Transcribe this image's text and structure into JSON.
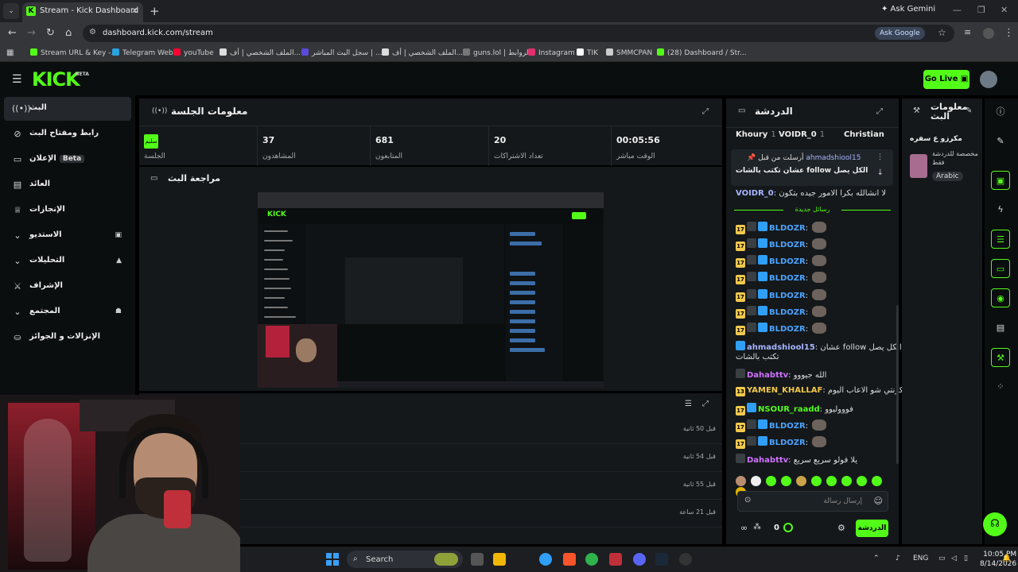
{
  "browser": {
    "tab_title": "Stream - Kick Dashboard",
    "tab_favicon": "K",
    "new_tab": "+",
    "ask_gemini": "✦ Ask Gemini",
    "url": "dashboard.kick.com/stream",
    "ask_google": "Ask Google",
    "bookmarks": [
      {
        "label": "Stream URL & Key -...",
        "color": "#53fc18"
      },
      {
        "label": "Telegram Web",
        "color": "#2aa3e0"
      },
      {
        "label": "youTube",
        "color": "#ff0033"
      },
      {
        "label": "الملف الشخصي | أف...",
        "color": "#dddddd"
      },
      {
        "label": "سجل البث المباشر | ...",
        "color": "#5a4bd8"
      },
      {
        "label": "الملف الشخصي | أف...",
        "color": "#dddddd"
      },
      {
        "label": "guns.lol | الروابط",
        "color": "#777777"
      },
      {
        "label": "Instagram",
        "color": "#e1306c"
      },
      {
        "label": "TIK",
        "color": "#ffffff"
      },
      {
        "label": "SMMCPAN",
        "color": "#cccccc"
      },
      {
        "label": "(28) Dashboard / Str...",
        "color": "#53fc18"
      }
    ]
  },
  "header": {
    "logo": "KICK",
    "beta": "BETA",
    "go_live": "Go Live"
  },
  "sidebar": {
    "items": [
      {
        "label": "البث",
        "icon": "broadcast-icon",
        "glyph": "((•))",
        "active": true
      },
      {
        "label": "رابط ومفتاح البث",
        "icon": "link-icon",
        "glyph": "⊘"
      },
      {
        "label": "الإعلان",
        "icon": "ad-icon",
        "glyph": "▭",
        "badge": "Beta"
      },
      {
        "label": "العائد",
        "icon": "revenue-icon",
        "glyph": "▤"
      },
      {
        "label": "الإنجازات",
        "icon": "trophy-icon",
        "glyph": "♕"
      },
      {
        "label": "الاستديو",
        "icon": "chevron-down-icon",
        "glyph": "⌄",
        "right": "▣"
      },
      {
        "label": "التحليلات",
        "icon": "chevron-down-icon",
        "glyph": "⌄",
        "right": "▲"
      },
      {
        "label": "الإشراف",
        "icon": "sword-icon",
        "glyph": "⚔"
      },
      {
        "label": "المجتمع",
        "icon": "chevron-down-icon",
        "glyph": "⌄",
        "right": "☗"
      },
      {
        "label": "الإنزالات و الجوائز",
        "icon": "gift-icon",
        "glyph": "⛀"
      }
    ]
  },
  "session": {
    "title": "معلومات الجلسة",
    "stats": [
      {
        "value": "",
        "label": "الجلسة",
        "badge": "سليم"
      },
      {
        "value": "37",
        "label": "المشاهدون"
      },
      {
        "value": "681",
        "label": "المتابعون"
      },
      {
        "value": "20",
        "label": "تعداد الاشتراكات"
      },
      {
        "value": "00:05:56",
        "label": "الوقت مباشر"
      }
    ]
  },
  "preview": {
    "title": "مراجعة البث"
  },
  "activity": {
    "rows": [
      {
        "time": "قبل 50 ثانية"
      },
      {
        "time": "قبل 54 ثانية"
      },
      {
        "time": "قبل 55 ثانية"
      },
      {
        "time": "قبل 21 ساعة"
      }
    ]
  },
  "chat": {
    "title": "الدردشة",
    "gifters": [
      {
        "name": "Khoury",
        "num": "1"
      },
      {
        "name": "VOIDR_0",
        "num": "1"
      },
      {
        "name": "Christian",
        "num": ""
      }
    ],
    "pinned": {
      "meta": "أرسلت من قبل",
      "user": "ahmadshiool15",
      "message": "عشان تكتب بالشات follow الكل يصل"
    },
    "messages": [
      {
        "user": "VOIDR_0",
        "color": "#a7b4ff",
        "text": "لا انشالله بكرا الامور جيده بتكون",
        "badges": []
      },
      {
        "user": "BLDOZR",
        "color": "#4aa3ff",
        "text": "",
        "badges": [
          "sub17",
          "gift",
          "verified"
        ],
        "emote": true
      },
      {
        "user": "BLDOZR",
        "color": "#4aa3ff",
        "text": "",
        "badges": [
          "sub17",
          "gift",
          "verified"
        ],
        "emote": true
      },
      {
        "user": "BLDOZR",
        "color": "#4aa3ff",
        "text": "",
        "badges": [
          "sub17",
          "gift",
          "verified"
        ],
        "emote": true
      },
      {
        "user": "BLDOZR",
        "color": "#4aa3ff",
        "text": "",
        "badges": [
          "sub17",
          "gift",
          "verified"
        ],
        "emote": true
      },
      {
        "user": "BLDOZR",
        "color": "#4aa3ff",
        "text": "",
        "badges": [
          "sub17",
          "gift",
          "verified"
        ],
        "emote": true
      },
      {
        "user": "BLDOZR",
        "color": "#4aa3ff",
        "text": "",
        "badges": [
          "sub17",
          "gift",
          "verified"
        ],
        "emote": true
      },
      {
        "user": "BLDOZR",
        "color": "#4aa3ff",
        "text": "",
        "badges": [
          "sub17",
          "gift",
          "verified"
        ],
        "emote": true
      },
      {
        "user": "ahmadshiool15",
        "color": "#a7b4ff",
        "text": "عشان follow الكل يصل",
        "badges": [
          "verified"
        ]
      },
      {
        "user": "",
        "color": "#ddd",
        "text": "تكتب بالشات",
        "badges": []
      },
      {
        "user": "Dahabttv",
        "color": "#d072ff",
        "text": "الله جيووو",
        "badges": [
          "gift"
        ]
      },
      {
        "user": "YAMEN_KHALLAF",
        "color": "#f2c94c",
        "text": "كرنتي شو الاعاب اليوم",
        "badges": [
          "sub13"
        ]
      },
      {
        "user": "NSOUR_raadd",
        "color": "#53fc18",
        "text": "فوووليوو",
        "badges": [
          "sub17",
          "verified"
        ]
      },
      {
        "user": "BLDOZR",
        "color": "#4aa3ff",
        "text": "",
        "badges": [
          "sub17",
          "gift",
          "verified"
        ],
        "emote": true
      },
      {
        "user": "BLDOZR",
        "color": "#4aa3ff",
        "text": "",
        "badges": [
          "sub17",
          "gift",
          "verified"
        ],
        "emote": true
      },
      {
        "user": "Dahabttv",
        "color": "#d072ff",
        "text": "يلا فولو سريع سريع",
        "badges": [
          "gift"
        ]
      }
    ],
    "new_messages": "رسائل جديدة",
    "input_placeholder": "إرسال رسالة",
    "count": "0",
    "send_label": "الدردشة"
  },
  "stream_info": {
    "title": "معلومات البث",
    "subtitle": "مكرزو ع سفره",
    "category": "مخصصة للدردشة فقط",
    "tag": "Arabic"
  },
  "taskbar": {
    "search": "Search",
    "lang": "ENG",
    "time": "10:05 PM",
    "date": "8/14/2026"
  },
  "colors": {
    "accent": "#53fc18",
    "panel": "#14181b",
    "background": "#0b0e0f"
  }
}
